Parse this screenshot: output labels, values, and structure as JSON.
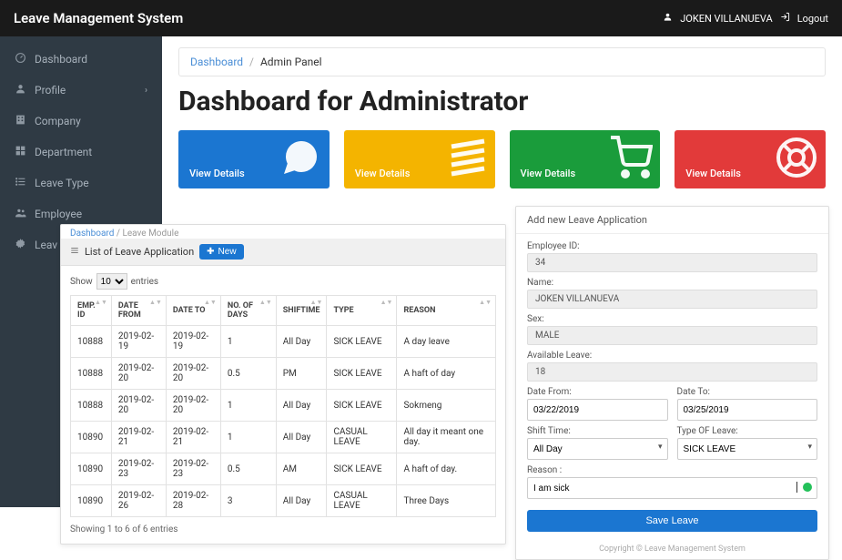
{
  "topbar": {
    "title": "Leave Management System",
    "user": "JOKEN VILLANUEVA",
    "logout": "Logout"
  },
  "sidebar": {
    "items": [
      {
        "label": "Dashboard",
        "icon": "dashboard"
      },
      {
        "label": "Profile",
        "icon": "user",
        "expandable": true
      },
      {
        "label": "Company",
        "icon": "building"
      },
      {
        "label": "Department",
        "icon": "grid"
      },
      {
        "label": "Leave Type",
        "icon": "list"
      },
      {
        "label": "Employee",
        "icon": "users"
      },
      {
        "label": "Leav",
        "icon": "gear"
      }
    ]
  },
  "breadcrumb": {
    "root": "Dashboard",
    "current": "Admin Panel"
  },
  "page_title": "Dashboard for Administrator",
  "tiles": [
    {
      "label": "View Details",
      "color": "blue"
    },
    {
      "label": "View Details",
      "color": "yellow"
    },
    {
      "label": "View Details",
      "color": "green"
    },
    {
      "label": "View Details",
      "color": "red"
    }
  ],
  "list_panel": {
    "crumb_root": "Dashboard",
    "crumb_current": " / Leave Module",
    "title": "List of Leave Application",
    "new_button": "New",
    "show_prefix": "Show",
    "show_value": "10",
    "show_suffix": "entries",
    "columns": [
      "EMP. ID",
      "DATE FROM",
      "DATE TO",
      "NO. OF DAYS",
      "SHIFTIME",
      "TYPE",
      "REASON"
    ],
    "rows": [
      [
        "10888",
        "2019-02-19",
        "2019-02-19",
        "1",
        "All Day",
        "SICK LEAVE",
        "A day leave"
      ],
      [
        "10888",
        "2019-02-20",
        "2019-02-20",
        "0.5",
        "PM",
        "SICK LEAVE",
        "A haft of day"
      ],
      [
        "10888",
        "2019-02-20",
        "2019-02-20",
        "1",
        "All Day",
        "SICK LEAVE",
        "Sokmeng"
      ],
      [
        "10890",
        "2019-02-21",
        "2019-02-21",
        "1",
        "All Day",
        "CASUAL LEAVE",
        "All day it meant one day."
      ],
      [
        "10890",
        "2019-02-23",
        "2019-02-23",
        "0.5",
        "AM",
        "SICK LEAVE",
        "A haft of day."
      ],
      [
        "10890",
        "2019-02-26",
        "2019-02-28",
        "3",
        "All Day",
        "CASUAL LEAVE",
        "Three Days"
      ]
    ],
    "info": "Showing 1 to 6 of 6 entries"
  },
  "form": {
    "header": "Add new Leave Application",
    "employee_id_label": "Employee ID:",
    "employee_id_value": "34",
    "name_label": "Name:",
    "name_value": "JOKEN VILLANUEVA",
    "sex_label": "Sex:",
    "sex_value": "MALE",
    "available_label": "Available Leave:",
    "available_value": "18",
    "date_from_label": "Date From:",
    "date_from_value": "03/22/2019",
    "date_to_label": "Date To:",
    "date_to_value": "03/25/2019",
    "shift_label": "Shift Time:",
    "shift_value": "All Day",
    "type_label": "Type OF Leave:",
    "type_value": "SICK LEAVE",
    "reason_label": "Reason :",
    "reason_value": "I am sick",
    "save_button": "Save Leave",
    "footer": "Copyright © Leave Management System"
  }
}
